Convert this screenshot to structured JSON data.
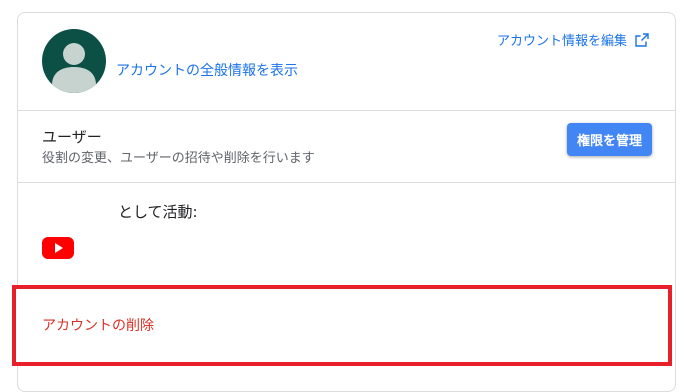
{
  "account": {
    "view_all_link": "アカウントの全般情報を表示",
    "edit_link": "アカウント情報を編集"
  },
  "users": {
    "title": "ユーザー",
    "subtitle": "役割の変更、ユーザーの招待や削除を行います",
    "manage_button": "権限を管理"
  },
  "acting_as": {
    "label": "として活動:",
    "channel_icon": "youtube-icon"
  },
  "danger": {
    "delete_link": "アカウントの削除"
  },
  "colors": {
    "link": "#1a73e8",
    "button": "#4285f4",
    "danger": "#d93025",
    "highlight": "#e8202a",
    "avatar_bg": "#0b4f45"
  }
}
